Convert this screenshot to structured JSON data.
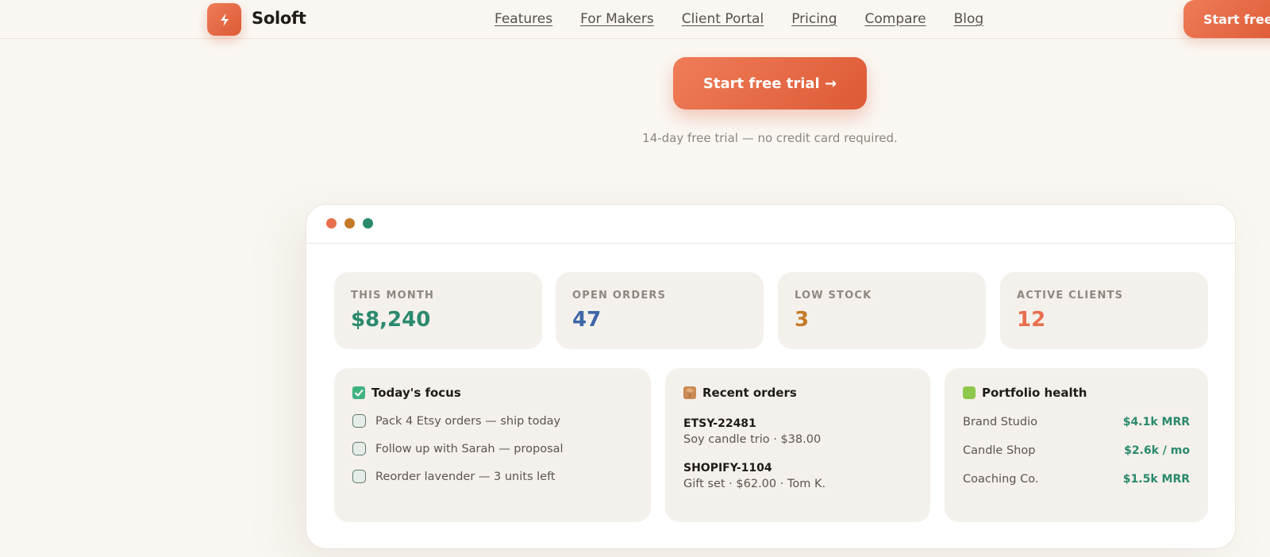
{
  "nav": {
    "brand": "Soloft",
    "links": [
      "Features",
      "For Makers",
      "Client Portal",
      "Pricing",
      "Compare",
      "Blog"
    ],
    "cta": "Start free"
  },
  "hero": {
    "cta": "Start free trial →",
    "note": "14-day free trial — no credit card required."
  },
  "dashboard": {
    "stats": [
      {
        "label": "THIS MONTH",
        "value": "$8,240",
        "color": "#2a8a6d"
      },
      {
        "label": "OPEN ORDERS",
        "value": "47",
        "color": "#3d66a8"
      },
      {
        "label": "LOW STOCK",
        "value": "3",
        "color": "#c47a28"
      },
      {
        "label": "ACTIVE CLIENTS",
        "value": "12",
        "color": "#e86f4c"
      }
    ],
    "focus": {
      "title": "Today's focus",
      "tasks": [
        "Pack 4 Etsy orders — ship today",
        "Follow up with Sarah — proposal",
        "Reorder lavender — 3 units left"
      ]
    },
    "orders": {
      "title": "Recent orders",
      "items": [
        {
          "id": "ETSY-22481",
          "desc": "Soy candle trio · $38.00"
        },
        {
          "id": "SHOPIFY-1104",
          "desc": "Gift set · $62.00 · Tom K."
        }
      ]
    },
    "portfolio": {
      "title": "Portfolio health",
      "rows": [
        {
          "name": "Brand Studio",
          "value": "$4.1k MRR"
        },
        {
          "name": "Candle Shop",
          "value": "$2.6k / mo"
        },
        {
          "name": "Coaching Co.",
          "value": "$1.5k MRR"
        }
      ]
    }
  }
}
